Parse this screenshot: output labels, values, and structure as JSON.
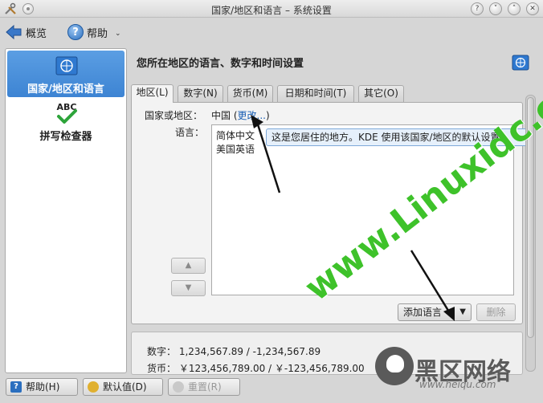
{
  "window": {
    "title": "国家/地区和语言 – 系统设置"
  },
  "toolbar": {
    "overview": "概览",
    "help": "帮助"
  },
  "sidebar": {
    "items": [
      {
        "label": "国家/地区和语言",
        "icon": "un-flag-icon",
        "selected": true
      },
      {
        "label": "拼写检查器",
        "icon": "spellcheck-icon",
        "icon_text": "ABC",
        "selected": false
      }
    ]
  },
  "module": {
    "title": "您所在地区的语言、数字和时间设置"
  },
  "tabs": [
    {
      "label": "地区(L)",
      "active": true
    },
    {
      "label": "数字(N)",
      "active": false
    },
    {
      "label": "货币(M)",
      "active": false
    },
    {
      "label": "日期和时间(T)",
      "active": false
    },
    {
      "label": "其它(O)",
      "active": false
    }
  ],
  "region": {
    "country_label": "国家或地区：",
    "country_value": "中国",
    "change_link": "更改...",
    "language_label": "语言：",
    "languages": [
      "简体中文",
      "美国英语"
    ],
    "tooltip": "这是您居住的地方。KDE 使用该国家/地区的默认设置。",
    "add_language": "添加语言",
    "remove": "删除"
  },
  "preview": {
    "number": "数字：  1,234,567.89 / -1,234,567.89",
    "currency": "货币：  ￥123,456,789.00 / ￥-123,456,789.00"
  },
  "bottom": {
    "help": "帮助(H)",
    "defaults": "默认值(D)",
    "reset": "重置(R)"
  },
  "watermark": {
    "site": "www.Linuxidc.com",
    "brand": "黑区网络",
    "sub": "www.heiqu.com"
  },
  "colors": {
    "selection": "#4a90d9",
    "link": "#1a5fb4",
    "tooltip_bg": "#e6f0fb",
    "watermark_green": "#3ec22a"
  }
}
